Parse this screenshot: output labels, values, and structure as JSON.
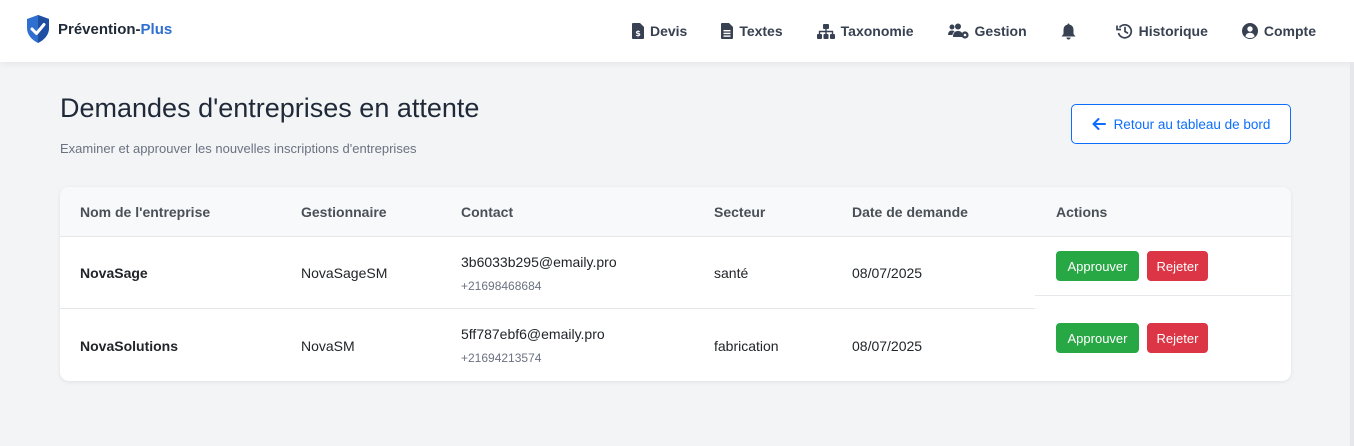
{
  "brand": {
    "name_part1": "Prévention-",
    "name_part2": "Plus"
  },
  "nav": {
    "devis": "Devis",
    "textes": "Textes",
    "taxonomie": "Taxonomie",
    "gestion": "Gestion",
    "historique": "Historique",
    "compte": "Compte"
  },
  "page": {
    "title": "Demandes d'entreprises en attente",
    "subtitle": "Examiner et approuver les nouvelles inscriptions d'entreprises",
    "back_button": "Retour au tableau de bord"
  },
  "table": {
    "headers": [
      "Nom de l'entreprise",
      "Gestionnaire",
      "Contact",
      "Secteur",
      "Date de demande",
      "Actions"
    ],
    "rows": [
      {
        "company": "NovaSage",
        "manager": "NovaSageSM",
        "email": "3b6033b295@emaily.pro",
        "phone": "+21698468684",
        "sector": "santé",
        "date": "08/07/2025"
      },
      {
        "company": "NovaSolutions",
        "manager": "NovaSM",
        "email": "5ff787ebf6@emaily.pro",
        "phone": "+21694213574",
        "sector": "fabrication",
        "date": "08/07/2025"
      }
    ],
    "approve_label": "Approuver",
    "reject_label": "Rejeter"
  },
  "colors": {
    "accent": "#0d6efd",
    "brand": "#2f6fd0",
    "approve": "#28a745",
    "reject": "#dc3545"
  }
}
